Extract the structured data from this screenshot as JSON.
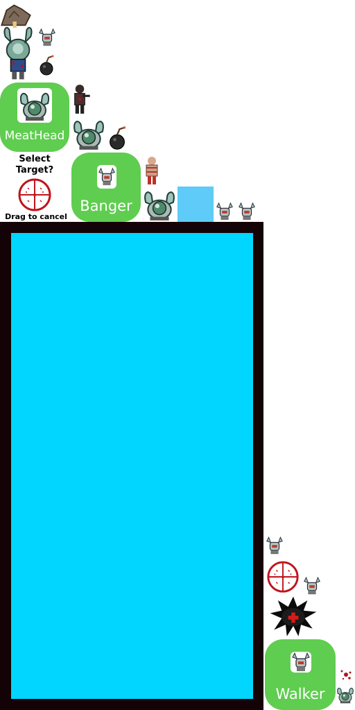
{
  "units": {
    "meathead": {
      "label": "MeatHead"
    },
    "banger": {
      "label": "Banger"
    },
    "walker": {
      "label": "Walker"
    }
  },
  "prompt": {
    "select_target": "Select\nTarget?",
    "drag_to_cancel": "Drag to cancel"
  },
  "colors": {
    "button_green": "#5fcd4f",
    "board_frame": "#140306",
    "board_field": "#00d6ff",
    "slot_blue": "#5ecbf8",
    "crosshair_red": "#c0141c"
  },
  "icons": {
    "crosshair": "crosshair-icon",
    "explosion": "explosion-crater-icon",
    "zombie": "zombie-sprite"
  }
}
